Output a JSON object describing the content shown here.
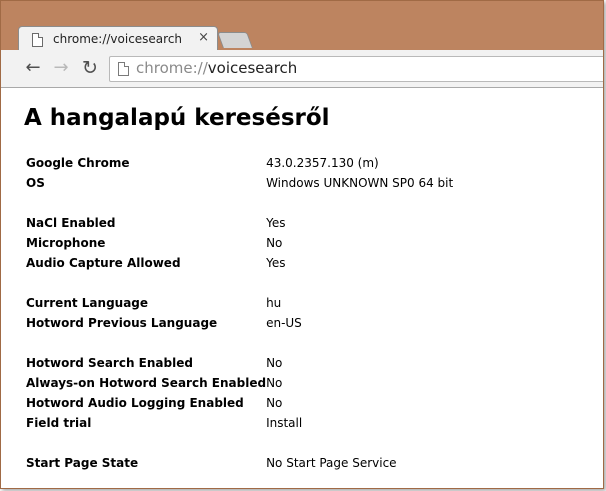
{
  "browser": {
    "tab": {
      "title": "chrome://voicesearch",
      "close_glyph": "×",
      "icon": "page-icon"
    },
    "toolbar": {
      "back_glyph": "←",
      "forward_glyph": "→",
      "reload_glyph": "↻",
      "url_scheme": "chrome://",
      "url_path": "voicesearch",
      "url_icon": "page-icon"
    },
    "colors": {
      "frame": "#bd8460",
      "toolbar": "#f2f2f2"
    }
  },
  "page": {
    "heading": "A hangalapú keresésről",
    "groups": [
      {
        "rows": [
          {
            "key": "Google Chrome",
            "value": "43.0.2357.130 (m)"
          },
          {
            "key": "OS",
            "value": "Windows UNKNOWN SP0 64 bit"
          }
        ]
      },
      {
        "rows": [
          {
            "key": "NaCl Enabled",
            "value": "Yes"
          },
          {
            "key": "Microphone",
            "value": "No"
          },
          {
            "key": "Audio Capture Allowed",
            "value": "Yes"
          }
        ]
      },
      {
        "rows": [
          {
            "key": "Current Language",
            "value": "hu"
          },
          {
            "key": "Hotword Previous Language",
            "value": "en-US"
          }
        ]
      },
      {
        "rows": [
          {
            "key": "Hotword Search Enabled",
            "value": "No"
          },
          {
            "key": "Always-on Hotword Search Enabled",
            "value": "No"
          },
          {
            "key": "Hotword Audio Logging Enabled",
            "value": "No"
          },
          {
            "key": "Field trial",
            "value": "Install"
          }
        ]
      },
      {
        "rows": [
          {
            "key": "Start Page State",
            "value": "No Start Page Service"
          }
        ]
      }
    ]
  }
}
